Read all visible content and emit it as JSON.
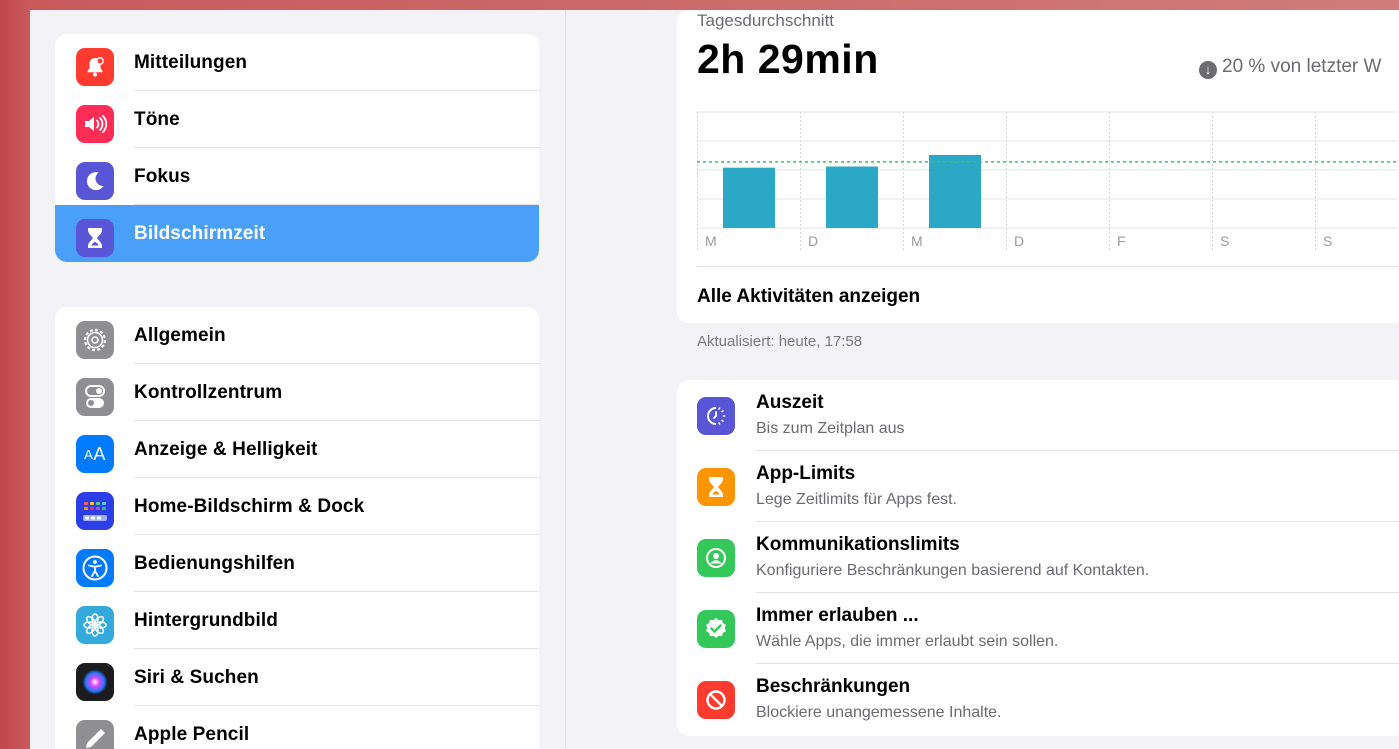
{
  "sidebar": {
    "group1": [
      {
        "label": "Mitteilungen",
        "icon": "bell-icon",
        "color": "#ff3b30"
      },
      {
        "label": "Töne",
        "icon": "speaker-icon",
        "color": "#ff2d55"
      },
      {
        "label": "Fokus",
        "icon": "moon-icon",
        "color": "#5856d6"
      },
      {
        "label": "Bildschirmzeit",
        "icon": "hourglass-icon",
        "color": "#5856d6",
        "selected": true
      }
    ],
    "group2": [
      {
        "label": "Allgemein",
        "icon": "gear-icon",
        "color": "#8e8e93"
      },
      {
        "label": "Kontrollzentrum",
        "icon": "toggles-icon",
        "color": "#8e8e93"
      },
      {
        "label": "Anzeige & Helligkeit",
        "icon": "text-size-icon",
        "color": "#007aff"
      },
      {
        "label": "Home-Bildschirm & Dock",
        "icon": "app-grid-icon",
        "color": "#2c3ee8"
      },
      {
        "label": "Bedienungshilfen",
        "icon": "accessibility-icon",
        "color": "#007aff"
      },
      {
        "label": "Hintergrundbild",
        "icon": "flower-icon",
        "color": "#34aadc"
      },
      {
        "label": "Siri & Suchen",
        "icon": "siri-icon",
        "color": "#1c1c1e"
      },
      {
        "label": "Apple Pencil",
        "icon": "pencil-icon",
        "color": "#8e8e93"
      }
    ]
  },
  "usage": {
    "avg_label": "Tagesdurchschnitt",
    "avg_value": "2h 29min",
    "trend": "20 % von letzter W",
    "show_all": "Alle Aktivitäten anzeigen",
    "updated": "Aktualisiert: heute, 17:58"
  },
  "chart_data": {
    "type": "bar",
    "categories": [
      "M",
      "D",
      "M",
      "D",
      "F",
      "S",
      "S"
    ],
    "values": [
      0.52,
      0.53,
      0.63,
      null,
      null,
      null,
      null
    ],
    "average_line": 0.57,
    "bar_color": "#2aa8c6",
    "average_color": "#34c759",
    "grid": true
  },
  "options": [
    {
      "title": "Auszeit",
      "subtitle": "Bis zum Zeitplan aus",
      "icon": "downtime-icon",
      "color": "#5856d6"
    },
    {
      "title": "App-Limits",
      "subtitle": "Lege Zeitlimits für Apps fest.",
      "icon": "hourglass-icon",
      "color": "#ff9500"
    },
    {
      "title": "Kommunikationslimits",
      "subtitle": "Konfiguriere Beschränkungen basierend auf Kontakten.",
      "icon": "contact-icon",
      "color": "#34c759"
    },
    {
      "title": "Immer erlauben ...",
      "subtitle": "Wähle Apps, die immer erlaubt sein sollen.",
      "icon": "checkmark-seal-icon",
      "color": "#34c759"
    },
    {
      "title": "Beschränkungen",
      "subtitle": "Blockiere unangemessene Inhalte.",
      "icon": "restriction-icon",
      "color": "#ff3b30"
    }
  ]
}
